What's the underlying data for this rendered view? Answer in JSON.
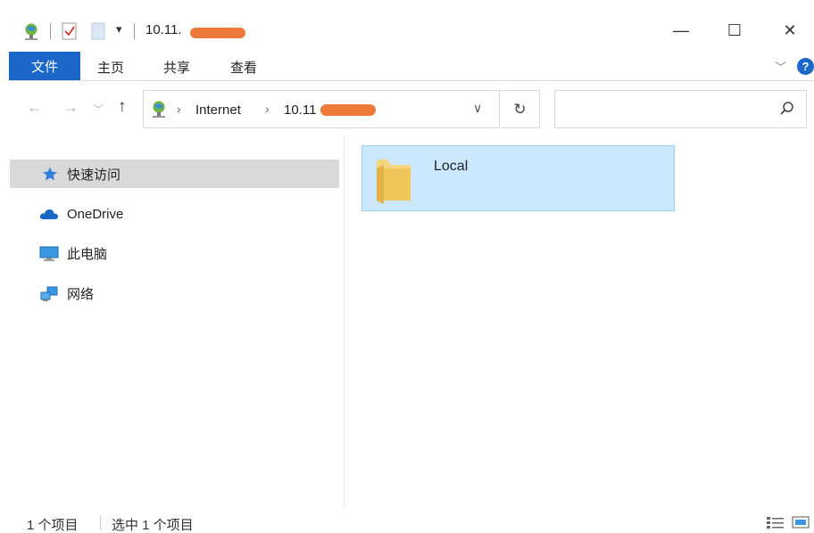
{
  "window": {
    "title": "10.11.",
    "minimize_glyph": "—",
    "maximize_glyph": "☐",
    "close_glyph": "✕"
  },
  "quick_access_toolbar": {
    "icons": [
      "network-location-icon",
      "properties-icon",
      "new-folder-icon"
    ],
    "dropdown_glyph": "▾"
  },
  "ribbon": {
    "tabs": [
      "文件",
      "主页",
      "共享",
      "查看"
    ],
    "expand_glyph": "﹀",
    "help_glyph": "?"
  },
  "navigation": {
    "back_glyph": "←",
    "forward_glyph": "→",
    "recent_glyph": "﹀",
    "up_glyph": "↑",
    "refresh_glyph": "↻",
    "dropdown_glyph": "∨"
  },
  "address_bar": {
    "segments": [
      "Internet",
      "10.11"
    ],
    "separator": "›"
  },
  "search": {
    "placeholder": "",
    "value": ""
  },
  "nav_pane": {
    "items": [
      {
        "label": "快速访问",
        "icon": "star-icon",
        "selected": true
      },
      {
        "label": "OneDrive",
        "icon": "cloud-icon",
        "selected": false
      },
      {
        "label": "此电脑",
        "icon": "computer-icon",
        "selected": false
      },
      {
        "label": "网络",
        "icon": "network-icon",
        "selected": false
      }
    ]
  },
  "content": {
    "items": [
      {
        "label": "Local",
        "icon": "folder-icon",
        "selected": true
      }
    ]
  },
  "status_bar": {
    "item_count": "1 个项目",
    "selected_count": "选中 1 个项目"
  },
  "colors": {
    "accent": "#1a66c9",
    "selection_bg": "#cce8ff",
    "selection_border": "#99d1ff",
    "nav_selected_bg": "#d9d9d9",
    "redaction": "#ee7a3a",
    "folder": "#f0c65a"
  }
}
